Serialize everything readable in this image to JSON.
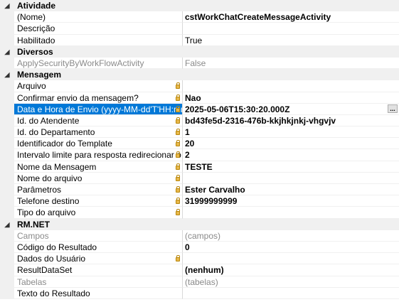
{
  "categories": [
    {
      "title": "Atividade",
      "rows": [
        {
          "name": "(Nome)",
          "value": "cstWorkChatCreateMessageActivity",
          "bold": true,
          "lock": false,
          "disabled": false
        },
        {
          "name": "Descrição",
          "value": "",
          "bold": false,
          "lock": false,
          "disabled": false
        },
        {
          "name": "Habilitado",
          "value": "True",
          "bold": false,
          "lock": false,
          "disabled": false
        }
      ]
    },
    {
      "title": "Diversos",
      "rows": [
        {
          "name": "ApplySecurityByWorkFlowActivity",
          "value": "False",
          "bold": false,
          "lock": false,
          "disabled": true
        }
      ]
    },
    {
      "title": "Mensagem",
      "rows": [
        {
          "name": "Arquivo",
          "value": "",
          "bold": false,
          "lock": true,
          "disabled": false
        },
        {
          "name": "Confirmar envio da mensagem?",
          "value": "Nao",
          "bold": true,
          "lock": true,
          "disabled": false
        },
        {
          "name": "Data e Hora de Envio (yyyy-MM-dd'T'HH:mm:ss",
          "value": "2025-05-06T15:30:20.000Z",
          "bold": true,
          "lock": true,
          "disabled": false,
          "selected": true,
          "ellipsis": "..."
        },
        {
          "name": "Id. do Atendente",
          "value": "bd43fe5d-2316-476b-kkjhkjnkj-vhgvjv",
          "bold": true,
          "lock": true,
          "disabled": false
        },
        {
          "name": "Id. do Departamento",
          "value": "1",
          "bold": true,
          "lock": true,
          "disabled": false
        },
        {
          "name": "Identificador do Template",
          "value": "20",
          "bold": true,
          "lock": true,
          "disabled": false
        },
        {
          "name": "Intervalo limite para resposta redirecionar o conta",
          "value": "2",
          "bold": true,
          "lock": true,
          "disabled": false
        },
        {
          "name": "Nome da Mensagem",
          "value": "TESTE",
          "bold": true,
          "lock": true,
          "disabled": false
        },
        {
          "name": "Nome do arquivo",
          "value": "",
          "bold": false,
          "lock": true,
          "disabled": false
        },
        {
          "name": "Parâmetros",
          "value": "Ester Carvalho",
          "bold": true,
          "lock": true,
          "disabled": false
        },
        {
          "name": "Telefone destino",
          "value": "31999999999",
          "bold": true,
          "lock": true,
          "disabled": false
        },
        {
          "name": "Tipo do arquivo",
          "value": "",
          "bold": false,
          "lock": true,
          "disabled": false
        }
      ]
    },
    {
      "title": "RM.NET",
      "rows": [
        {
          "name": "Campos",
          "value": "(campos)",
          "bold": false,
          "lock": false,
          "disabled": true
        },
        {
          "name": "Código do Resultado",
          "value": "0",
          "bold": true,
          "lock": false,
          "disabled": false
        },
        {
          "name": "Dados do Usuário",
          "value": "",
          "bold": false,
          "lock": true,
          "disabled": false
        },
        {
          "name": "ResultDataSet",
          "value": "(nenhum)",
          "bold": true,
          "lock": false,
          "disabled": false
        },
        {
          "name": "Tabelas",
          "value": "(tabelas)",
          "bold": false,
          "lock": false,
          "disabled": true
        },
        {
          "name": "Texto do Resultado",
          "value": "",
          "bold": false,
          "lock": false,
          "disabled": false
        }
      ]
    }
  ],
  "icons": {
    "collapse": "collapse-triangle-icon",
    "lock": "lock-icon"
  },
  "colors": {
    "selection": "#0078d7",
    "category_bg": "#f0f0f0",
    "lock": "#e8b84a",
    "disabled_text": "#8a8a8a"
  }
}
